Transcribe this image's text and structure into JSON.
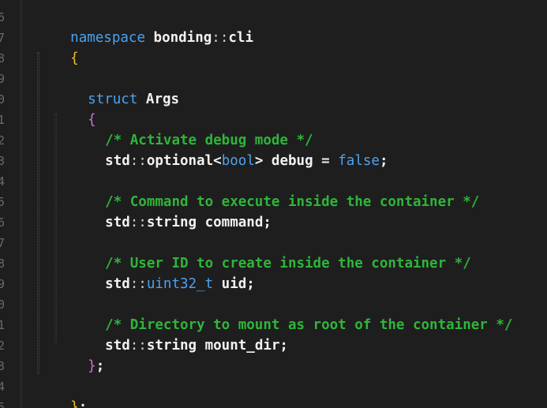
{
  "line_numbers": [
    "6",
    "7",
    "8",
    "9",
    "0",
    "1",
    "2",
    "3",
    "4",
    "5",
    "6",
    "7",
    "8",
    "9",
    "0",
    "1",
    "2",
    "3",
    "4",
    "5"
  ],
  "code": {
    "ns_keyword": "namespace",
    "ns_name": "bonding",
    "ns_sep": "::",
    "ns_sub": "cli",
    "open_brace_outer": "{",
    "struct_keyword": "struct",
    "struct_name": "Args",
    "open_brace_inner": "{",
    "comment_debug": "/* Activate debug mode */",
    "debug_std": "std",
    "debug_sep": "::",
    "debug_optional": "optional",
    "debug_lt": "<",
    "debug_bool": "bool",
    "debug_gt": ">",
    "debug_name": " debug ",
    "debug_eq": "=",
    "debug_false": "false",
    "debug_semi": ";",
    "comment_command": "/* Command to execute inside the container */",
    "command_std": "std",
    "command_sep": "::",
    "command_type": "string",
    "command_name": " command",
    "command_semi": ";",
    "comment_uid": "/* User ID to create inside the container */",
    "uid_std": "std",
    "uid_sep": "::",
    "uid_type": "uint32_t",
    "uid_name": " uid",
    "uid_semi": ";",
    "comment_mount": "/* Directory to mount as root of the container */",
    "mount_std": "std",
    "mount_sep": "::",
    "mount_type": "string",
    "mount_name": " mount_dir",
    "mount_semi": ";",
    "close_brace_inner": "}",
    "close_inner_semi": ";",
    "close_brace_outer": "}",
    "close_outer_semi": ";"
  },
  "colors": {
    "background": "#1e1e1e",
    "keyword": "#4aa3f2",
    "comment": "#2fb53a",
    "brace_outer": "#f0c020",
    "brace_inner": "#d070d0",
    "text": "#f2f2f2"
  }
}
